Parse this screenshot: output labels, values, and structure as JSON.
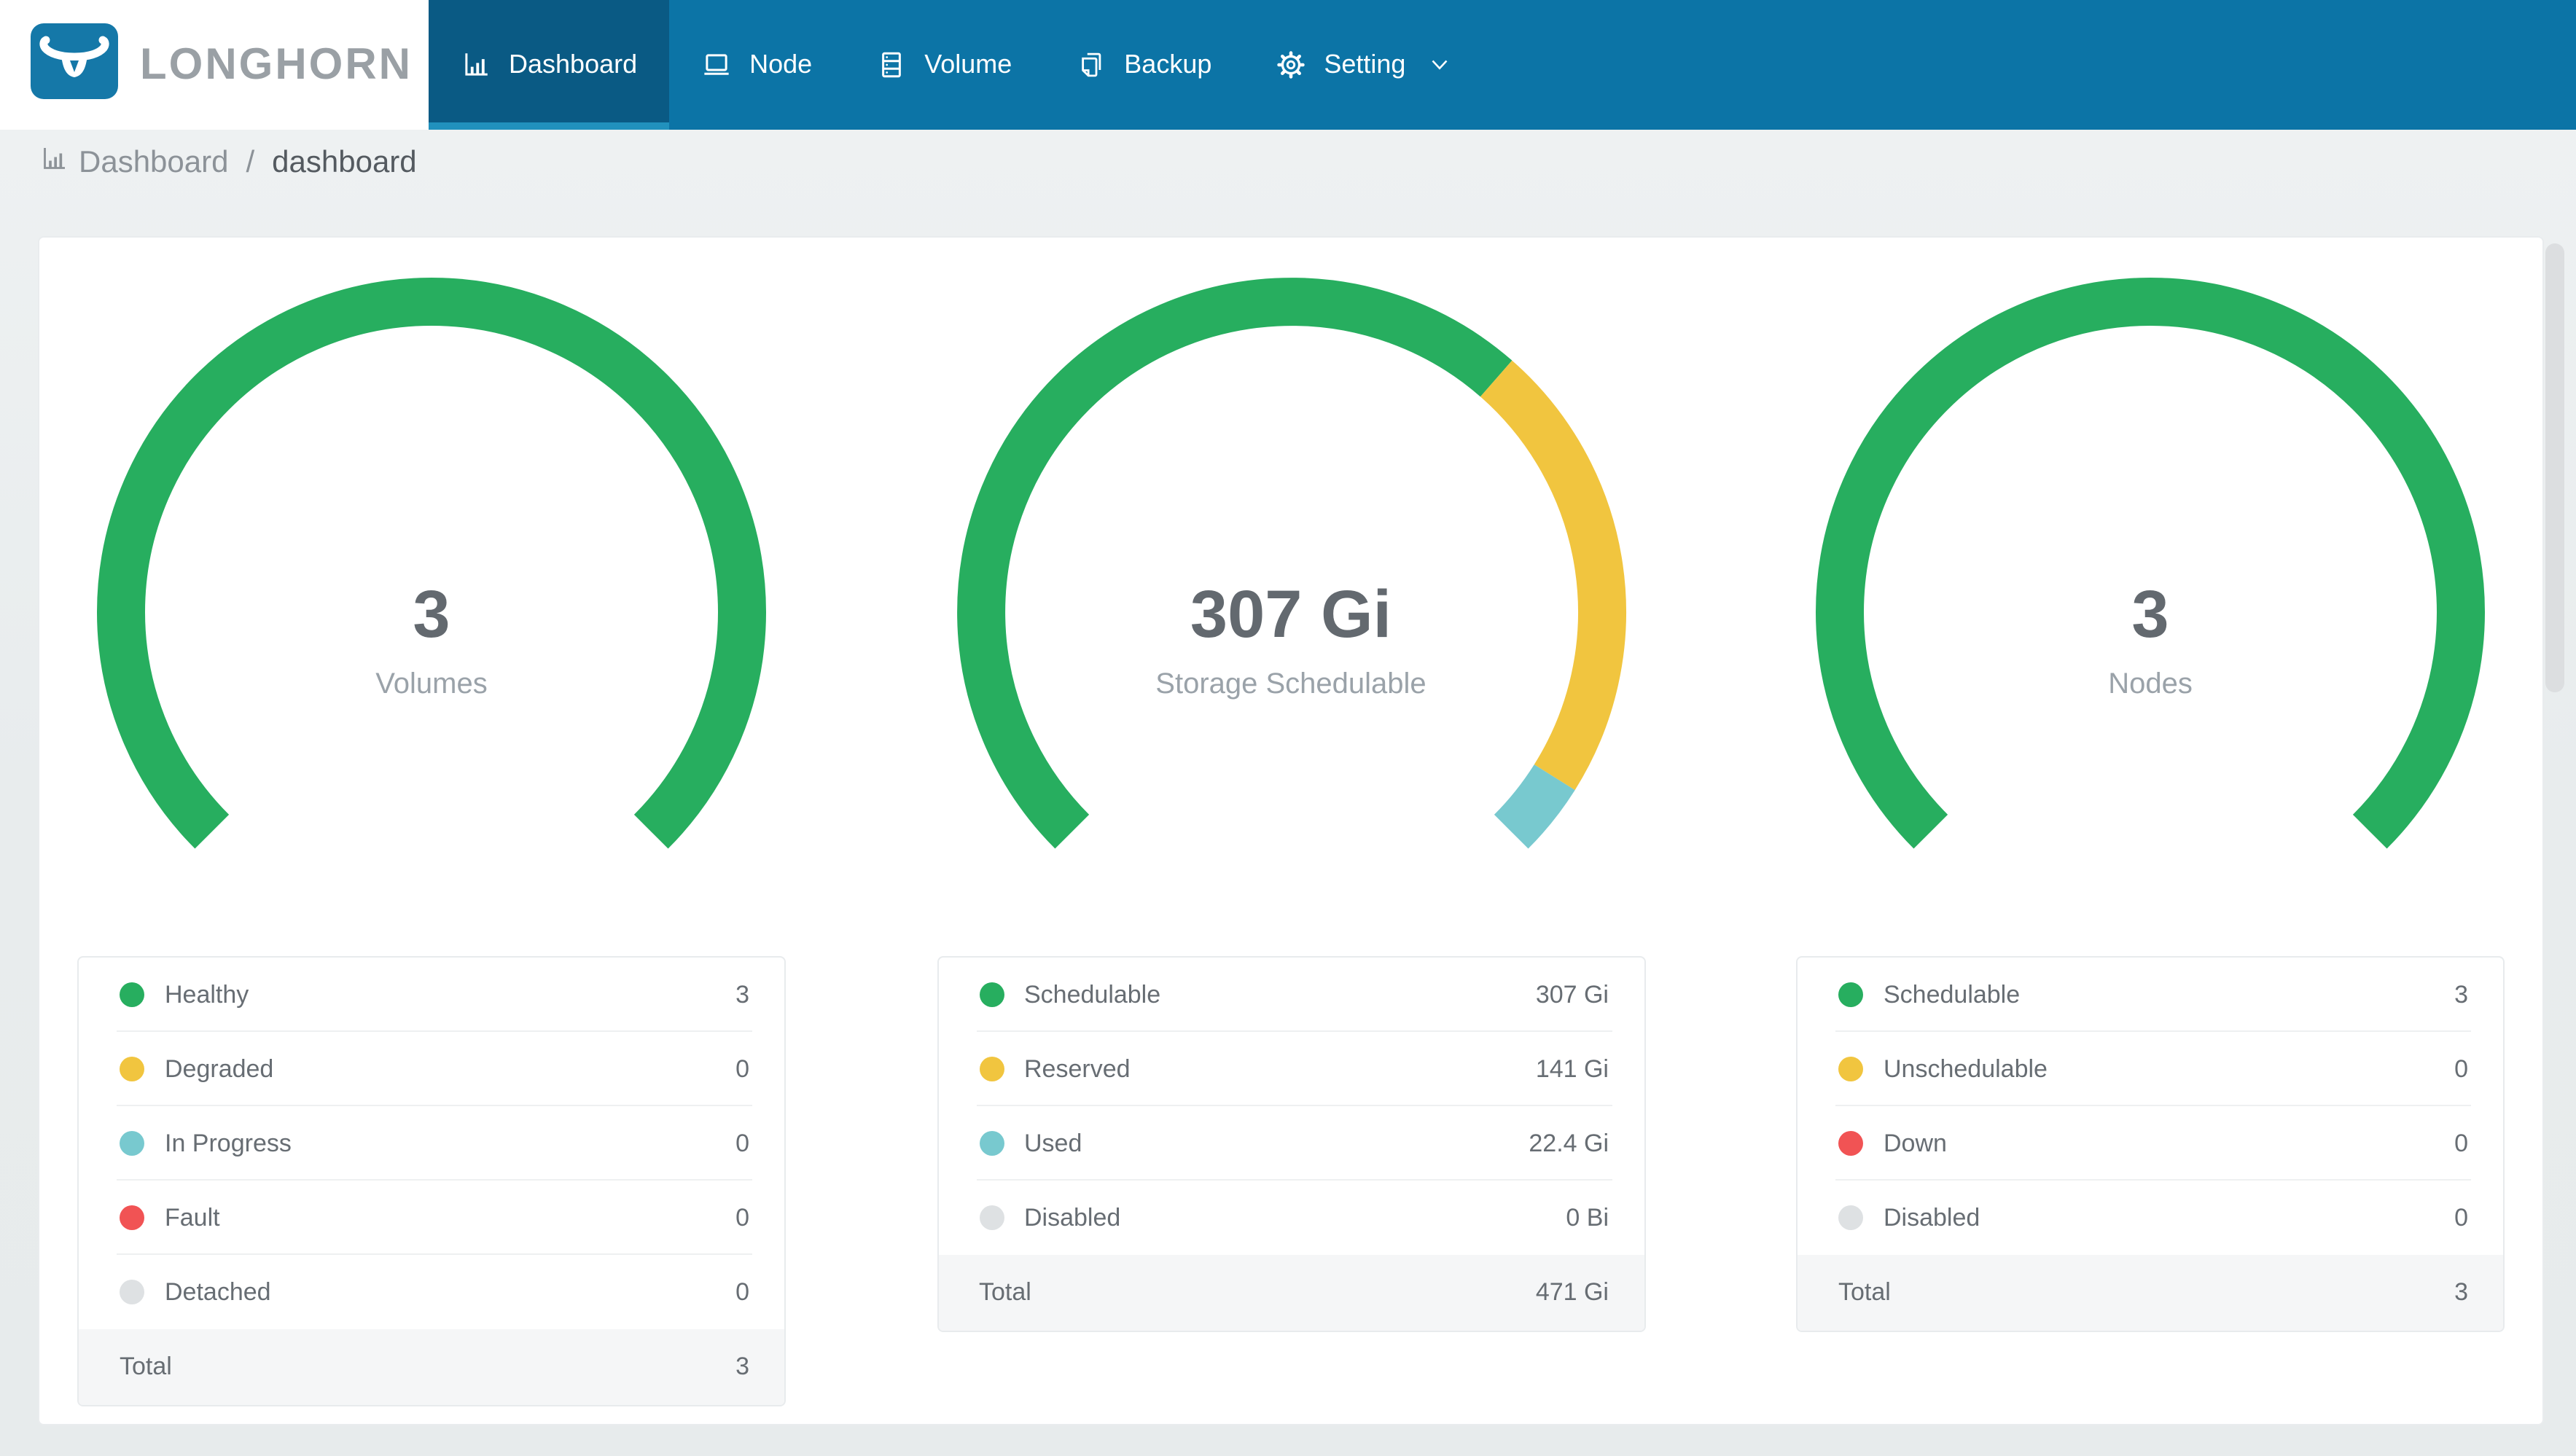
{
  "brand": {
    "name": "LONGHORN"
  },
  "colors": {
    "brand_blue": "#1578A8",
    "nav_blue": "#0C74A6",
    "nav_active_blue": "#0A5A84",
    "nav_underline_blue": "#2191BD",
    "healthy_green": "#27AE5F",
    "warning_yellow": "#F1C53F",
    "progress_teal": "#78C9CF",
    "fault_red": "#F15354",
    "disabled_gray": "#DEE1E3"
  },
  "nav": {
    "items": [
      {
        "label": "Dashboard",
        "icon": "bar-chart-icon",
        "active": true
      },
      {
        "label": "Node",
        "icon": "laptop-icon",
        "active": false
      },
      {
        "label": "Volume",
        "icon": "database-icon",
        "active": false
      },
      {
        "label": "Backup",
        "icon": "copy-icon",
        "active": false
      },
      {
        "label": "Setting",
        "icon": "gear-icon",
        "active": false,
        "has_dropdown": true
      }
    ]
  },
  "breadcrumb": {
    "icon": "bar-chart-icon",
    "root": "Dashboard",
    "separator": "/",
    "current": "dashboard"
  },
  "chart_data": [
    {
      "type": "pie",
      "variant": "gauge-donut",
      "title": "Volumes",
      "center_value": "3",
      "start_angle": 225,
      "arc_degrees": 270,
      "segments": [
        {
          "name": "Healthy",
          "value": 3,
          "color": "#27AE5F"
        },
        {
          "name": "Degraded",
          "value": 0,
          "color": "#F1C53F"
        },
        {
          "name": "In Progress",
          "value": 0,
          "color": "#78C9CF"
        },
        {
          "name": "Fault",
          "value": 0,
          "color": "#F15354"
        },
        {
          "name": "Detached",
          "value": 0,
          "color": "#DEE1E3"
        }
      ],
      "total": 3
    },
    {
      "type": "pie",
      "variant": "gauge-donut",
      "title": "Storage Schedulable",
      "center_value": "307 Gi",
      "unit": "Gi",
      "start_angle": 225,
      "arc_degrees": 270,
      "segments": [
        {
          "name": "Schedulable",
          "value": 307,
          "color": "#27AE5F"
        },
        {
          "name": "Reserved",
          "value": 141,
          "color": "#F1C53F"
        },
        {
          "name": "Used",
          "value": 22.4,
          "color": "#78C9CF"
        },
        {
          "name": "Disabled",
          "value": 0,
          "color": "#DEE1E3"
        }
      ],
      "total": "471 Gi"
    },
    {
      "type": "pie",
      "variant": "gauge-donut",
      "title": "Nodes",
      "center_value": "3",
      "start_angle": 225,
      "arc_degrees": 270,
      "segments": [
        {
          "name": "Schedulable",
          "value": 3,
          "color": "#27AE5F"
        },
        {
          "name": "Unschedulable",
          "value": 0,
          "color": "#F1C53F"
        },
        {
          "name": "Down",
          "value": 0,
          "color": "#F15354"
        },
        {
          "name": "Disabled",
          "value": 0,
          "color": "#DEE1E3"
        }
      ],
      "total": 3
    }
  ],
  "panels": [
    {
      "id": "volumes",
      "gauge": {
        "value": "3",
        "label": "Volumes"
      },
      "legend": {
        "rows": [
          {
            "label": "Healthy",
            "value": "3",
            "color": "#27AE5F"
          },
          {
            "label": "Degraded",
            "value": "0",
            "color": "#F1C53F"
          },
          {
            "label": "In Progress",
            "value": "0",
            "color": "#78C9CF"
          },
          {
            "label": "Fault",
            "value": "0",
            "color": "#F15354"
          },
          {
            "label": "Detached",
            "value": "0",
            "color": "#DEE1E3"
          }
        ],
        "total": {
          "label": "Total",
          "value": "3"
        }
      }
    },
    {
      "id": "storage",
      "gauge": {
        "value": "307 Gi",
        "label": "Storage Schedulable"
      },
      "legend": {
        "rows": [
          {
            "label": "Schedulable",
            "value": "307 Gi",
            "color": "#27AE5F"
          },
          {
            "label": "Reserved",
            "value": "141 Gi",
            "color": "#F1C53F"
          },
          {
            "label": "Used",
            "value": "22.4 Gi",
            "color": "#78C9CF"
          },
          {
            "label": "Disabled",
            "value": "0 Bi",
            "color": "#DEE1E3"
          }
        ],
        "total": {
          "label": "Total",
          "value": "471 Gi"
        }
      }
    },
    {
      "id": "nodes",
      "gauge": {
        "value": "3",
        "label": "Nodes"
      },
      "legend": {
        "rows": [
          {
            "label": "Schedulable",
            "value": "3",
            "color": "#27AE5F"
          },
          {
            "label": "Unschedulable",
            "value": "0",
            "color": "#F1C53F"
          },
          {
            "label": "Down",
            "value": "0",
            "color": "#F15354"
          },
          {
            "label": "Disabled",
            "value": "0",
            "color": "#DEE1E3"
          }
        ],
        "total": {
          "label": "Total",
          "value": "3"
        }
      }
    }
  ]
}
